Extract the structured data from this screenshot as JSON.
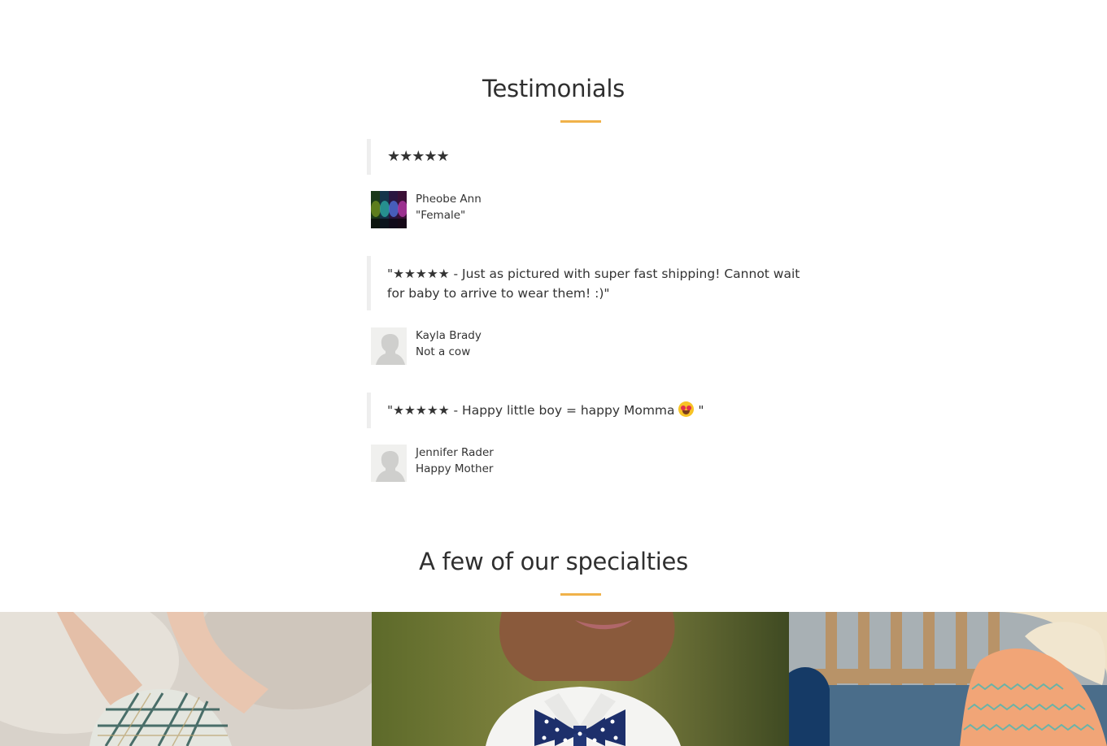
{
  "testimonials": {
    "title": "Testimonials",
    "items": [
      {
        "quote": "★★★★★",
        "name": "Pheobe Ann",
        "subtitle": "\"Female\"",
        "avatar": "colorful-portrait-avatar"
      },
      {
        "quote": "\"★★★★★ - Just as pictured with super fast shipping! Cannot wait for baby to arrive to wear them! :)\"",
        "name": "Kayla Brady",
        "subtitle": "Not a cow",
        "avatar": "default-user-avatar"
      },
      {
        "quote_text": "\"★★★★★ - Happy little boy = happy Momma",
        "quote_end": " \"",
        "quote_emoji": "heart-eyes-emoji",
        "name": "Jennifer Rader",
        "subtitle": "Happy Mother",
        "avatar": "default-user-avatar"
      }
    ]
  },
  "specialties": {
    "title": "A few of our specialties",
    "images": [
      "baby-feet-plaid-booties-photo",
      "boy-polka-dot-bow-tie-photo",
      "girl-chevron-blanket-photo"
    ]
  },
  "colors": {
    "accent": "#f0b24a",
    "text": "#333333",
    "quote_border": "#eeeeee"
  }
}
